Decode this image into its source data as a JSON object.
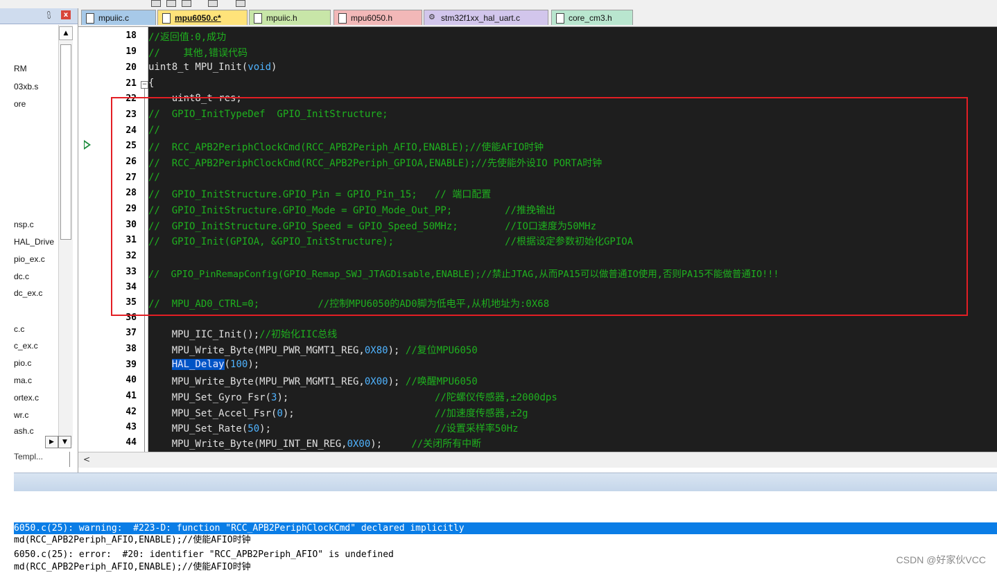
{
  "toolbar": {
    "icons": [
      "view-icon",
      "window-icon",
      "panel-icon",
      "layout-icon",
      "grid-icon"
    ]
  },
  "project_panel": {
    "pin_icon": "pin-icon",
    "close_icon": "close-icon",
    "items": [
      "RM",
      "03xb.s",
      "ore",
      "nsp.c",
      "HAL_Drive",
      "pio_ex.c",
      "dc.c",
      "dc_ex.c",
      "c.c",
      "c_ex.c",
      "pio.c",
      "ma.c",
      "ortex.c",
      "wr.c",
      "ash.c"
    ],
    "bottom_tab": "Templ..."
  },
  "tabs": [
    {
      "label": "mpuiic.c",
      "active": false,
      "color": "#a7c9e8"
    },
    {
      "label": "mpu6050.c*",
      "active": true,
      "color": "#ffe37a"
    },
    {
      "label": "mpuiic.h",
      "active": false,
      "color": "#c8e6a8"
    },
    {
      "label": "mpu6050.h",
      "active": false,
      "color": "#f2b8b8"
    },
    {
      "label": "stm32f1xx_hal_uart.c",
      "active": false,
      "color": "#d2c6ec"
    },
    {
      "label": "core_cm3.h",
      "active": false,
      "color": "#b9e6cf"
    }
  ],
  "editor": {
    "line_numbers": [
      "18",
      "19",
      "20",
      "21",
      "22",
      "23",
      "24",
      "25",
      "26",
      "27",
      "28",
      "29",
      "30",
      "31",
      "32",
      "33",
      "34",
      "35",
      "36",
      "37",
      "38",
      "39",
      "40",
      "41",
      "42",
      "43",
      "44"
    ],
    "code_text": {
      "l18": "//返回值:0,成功",
      "l19": "//    其他,错误代码",
      "l20a": "uint8_t MPU_Init(",
      "l20b": "void",
      "l20c": ")",
      "l21": "{",
      "l22": "    uint8_t res;",
      "l23": "//  GPIO_InitTypeDef  GPIO_InitStructure;",
      "l24": "//",
      "l25": "//  RCC_APB2PeriphClockCmd(RCC_APB2Periph_AFIO,ENABLE);//使能AFIO时钟",
      "l26": "//  RCC_APB2PeriphClockCmd(RCC_APB2Periph_GPIOA,ENABLE);//先使能外设IO PORTA时钟",
      "l27": "//",
      "l28": "//  GPIO_InitStructure.GPIO_Pin = GPIO_Pin_15;   // 端口配置",
      "l29": "//  GPIO_InitStructure.GPIO_Mode = GPIO_Mode_Out_PP;         //推挽输出",
      "l30": "//  GPIO_InitStructure.GPIO_Speed = GPIO_Speed_50MHz;        //IO口速度为50MHz",
      "l31": "//  GPIO_Init(GPIOA, &GPIO_InitStructure);                   //根据设定参数初始化GPIOA",
      "l32": "",
      "l33": "//  GPIO_PinRemapConfig(GPIO_Remap_SWJ_JTAGDisable,ENABLE);//禁止JTAG,从而PA15可以做普通IO使用,否则PA15不能做普通IO!!!",
      "l34": "",
      "l35": "//  MPU_AD0_CTRL=0;          //控制MPU6050的AD0脚为低电平,从机地址为:0X68",
      "l36": "",
      "l37a": "    MPU_IIC_Init();",
      "l37b": "//初始化IIC总线",
      "l38a": "    MPU_Write_Byte(MPU_PWR_MGMT1_REG,",
      "l38b": "0X80",
      "l38c": "); ",
      "l38d": "//复位MPU6050",
      "l39a": "    ",
      "l39b": "HAL_Delay",
      "l39c": "(",
      "l39d": "100",
      "l39e": ");",
      "l40a": "    MPU_Write_Byte(MPU_PWR_MGMT1_REG,",
      "l40b": "0X00",
      "l40c": "); ",
      "l40d": "//唤醒MPU6050",
      "l41a": "    MPU_Set_Gyro_Fsr(",
      "l41b": "3",
      "l41c": ");                         ",
      "l41d": "//陀螺仪传感器,±2000dps",
      "l42a": "    MPU_Set_Accel_Fsr(",
      "l42b": "0",
      "l42c": ");                        ",
      "l42d": "//加速度传感器,±2g",
      "l43a": "    MPU_Set_Rate(",
      "l43b": "50",
      "l43c": ");                            ",
      "l43d": "//设置采样率50Hz",
      "l44a": "    MPU_Write_Byte(MPU_INT_EN_REG,",
      "l44b": "0X00",
      "l44c": ");     ",
      "l44d": "//关闭所有中断"
    }
  },
  "build_output": {
    "lines": [
      "6050.c(25): warning:  #223-D: function \"RCC_APB2PeriphClockCmd\" declared implicitly",
      "md(RCC_APB2Periph_AFIO,ENABLE);//使能AFIO时钟",
      "6050.c(25): error:  #20: identifier \"RCC_APB2Periph_AFIO\" is undefined",
      "md(RCC_APB2Periph_AFIO,ENABLE);//使能AFIO时钟"
    ]
  },
  "watermark": "CSDN @好家伙VCC",
  "colors": {
    "comment": "#1fb11f",
    "number": "#4fb3ff",
    "highlight_box": "#e31e24",
    "selection": "#0a7de6"
  }
}
